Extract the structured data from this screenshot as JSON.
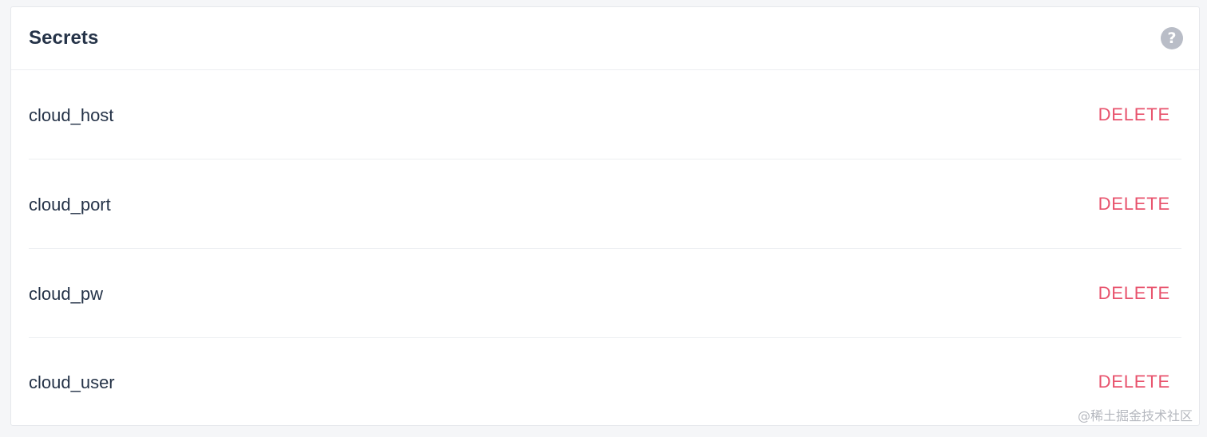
{
  "panel": {
    "title": "Secrets",
    "help_icon": "question-circle-icon"
  },
  "secrets": [
    {
      "name": "cloud_host",
      "action": "DELETE"
    },
    {
      "name": "cloud_port",
      "action": "DELETE"
    },
    {
      "name": "cloud_pw",
      "action": "DELETE"
    },
    {
      "name": "cloud_user",
      "action": "DELETE"
    }
  ],
  "watermark": "@稀土掘金技术社区",
  "colors": {
    "title_text": "#253348",
    "delete_accent": "#e8536d",
    "help_icon_bg": "#b9bdc7",
    "divider": "#eceef1"
  }
}
